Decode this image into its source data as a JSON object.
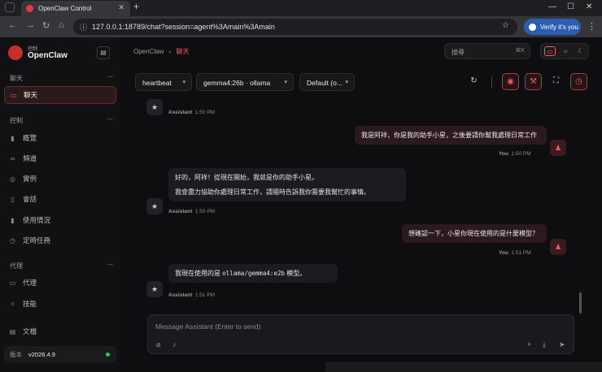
{
  "browser": {
    "tab_title": "OpenClaw Control",
    "new_tab": "+",
    "url": "127.0.0.1:18789/chat?session=agent%3Amain%3Amain",
    "profile_label": "Verify it's you",
    "win_min": "—",
    "win_max": "☐",
    "win_close": "✕"
  },
  "sidebar": {
    "brand_small": "控制",
    "brand": "OpenClaw",
    "sections": {
      "chat": "聊天",
      "control": "控制",
      "agent": "代理"
    },
    "items": {
      "chat": "聊天",
      "overview": "概覽",
      "channels": "頻道",
      "instances": "實例",
      "sessions": "會話",
      "usage": "使用情況",
      "cron": "定時任務",
      "agents": "代理",
      "skills": "技能",
      "docs": "文檔"
    },
    "version_label": "版本",
    "version": "v2026.4.9"
  },
  "header": {
    "crumb_root": "OpenClaw",
    "crumb_sep": "›",
    "crumb_current": "聊天",
    "search_placeholder": "搜尋",
    "search_kbd": "⌘K"
  },
  "toolbar": {
    "session": "heartbeat",
    "model": "gemma4:26b · ollama",
    "thinking": "Default (o..."
  },
  "messages": [
    {
      "role": "assistant",
      "sender": "Assistant",
      "time": "1:50 PM"
    },
    {
      "role": "user",
      "text": "我是阿祥，你是我的助手小星，之後要請你幫我處理日常工作",
      "sender": "You",
      "time": "1:50 PM"
    },
    {
      "role": "assistant",
      "lines": [
        "好的，阿祥！從現在開始，我就是你的助手小星。",
        "我會盡力協助你處理日常工作，請隨時告訴我你需要我幫忙的事情。"
      ],
      "sender": "Assistant",
      "time": "1:50 PM"
    },
    {
      "role": "user",
      "text": "想確認一下，小星你現在使用的是什麼模型？",
      "sender": "You",
      "time": "1:51 PM"
    },
    {
      "role": "assistant",
      "text_before": "我現在使用的是 ",
      "code": "ollama/gemma4:e2b",
      "text_after": " 模型。",
      "sender": "Assistant",
      "time": "1:51 PM"
    }
  ],
  "composer": {
    "placeholder": "Message Assistant (Enter to send)"
  },
  "colors": {
    "accent": "#f05a5a",
    "background": "#0e0e10",
    "online": "#2ecc52"
  }
}
